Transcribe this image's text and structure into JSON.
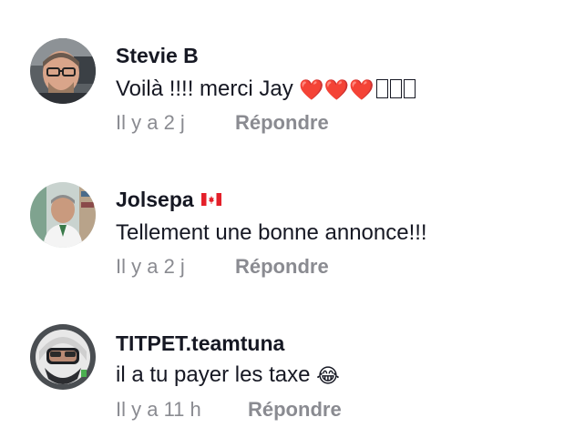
{
  "comments": [
    {
      "username": "Stevie B",
      "text": "Voilà !!!! merci Jay",
      "emoji": "❤️❤️❤️",
      "timestamp": "Il y a 2 j",
      "reply_label": "Répondre"
    },
    {
      "username": "Jolsepa",
      "badge": "canada-flag-icon",
      "text": "Tellement une bonne annonce!!!",
      "timestamp": "Il y a 2 j",
      "reply_label": "Répondre"
    },
    {
      "username": "TITPET.teamtuna",
      "text": "il a tu payer les taxe",
      "emoji": "😂",
      "timestamp": "Il y a 11 h",
      "reply_label": "Répondre"
    }
  ],
  "colors": {
    "text": "#161823",
    "secondary": "#8a8b91",
    "heart": "#e8142b"
  }
}
